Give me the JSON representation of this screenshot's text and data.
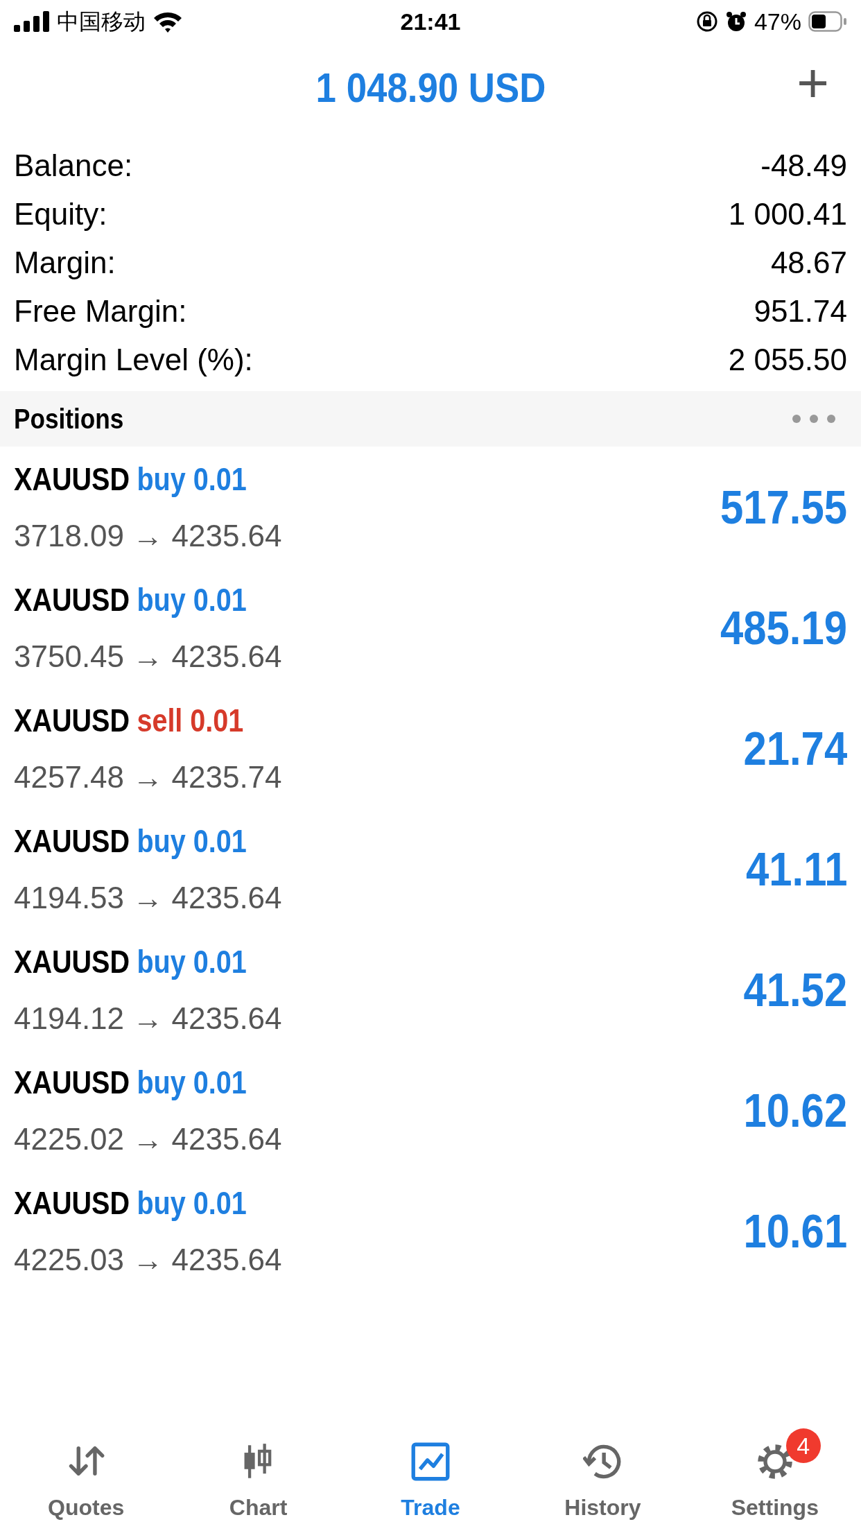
{
  "status_bar": {
    "carrier": "中国移动",
    "time": "21:41",
    "battery": "47%"
  },
  "header": {
    "title": "1 048.90 USD",
    "add_button": "+"
  },
  "summary": [
    {
      "label": "Balance:",
      "value": "-48.49"
    },
    {
      "label": "Equity:",
      "value": "1 000.41"
    },
    {
      "label": "Margin:",
      "value": "48.67"
    },
    {
      "label": "Free Margin:",
      "value": "951.74"
    },
    {
      "label": "Margin Level (%):",
      "value": "2 055.50"
    }
  ],
  "positions_header": {
    "title": "Positions"
  },
  "positions": [
    {
      "symbol": "XAUUSD",
      "kind": "buy",
      "order": "buy 0.01",
      "prices": "3718.09 → 4235.64",
      "profit": "517.55"
    },
    {
      "symbol": "XAUUSD",
      "kind": "buy",
      "order": "buy 0.01",
      "prices": "3750.45 → 4235.64",
      "profit": "485.19"
    },
    {
      "symbol": "XAUUSD",
      "kind": "sell",
      "order": "sell 0.01",
      "prices": "4257.48 → 4235.74",
      "profit": "21.74"
    },
    {
      "symbol": "XAUUSD",
      "kind": "buy",
      "order": "buy 0.01",
      "prices": "4194.53 → 4235.64",
      "profit": "41.11"
    },
    {
      "symbol": "XAUUSD",
      "kind": "buy",
      "order": "buy 0.01",
      "prices": "4194.12 → 4235.64",
      "profit": "41.52"
    },
    {
      "symbol": "XAUUSD",
      "kind": "buy",
      "order": "buy 0.01",
      "prices": "4225.02 → 4235.64",
      "profit": "10.62"
    },
    {
      "symbol": "XAUUSD",
      "kind": "buy",
      "order": "buy 0.01",
      "prices": "4225.03 → 4235.64",
      "profit": "10.61"
    }
  ],
  "tabs": [
    {
      "label": "Quotes",
      "kind": "quotes",
      "selected": false
    },
    {
      "label": "Chart",
      "kind": "chart",
      "selected": false
    },
    {
      "label": "Trade",
      "kind": "trade",
      "selected": true
    },
    {
      "label": "History",
      "kind": "history",
      "selected": false
    },
    {
      "label": "Settings",
      "kind": "settings",
      "selected": false,
      "badge": "4"
    }
  ]
}
